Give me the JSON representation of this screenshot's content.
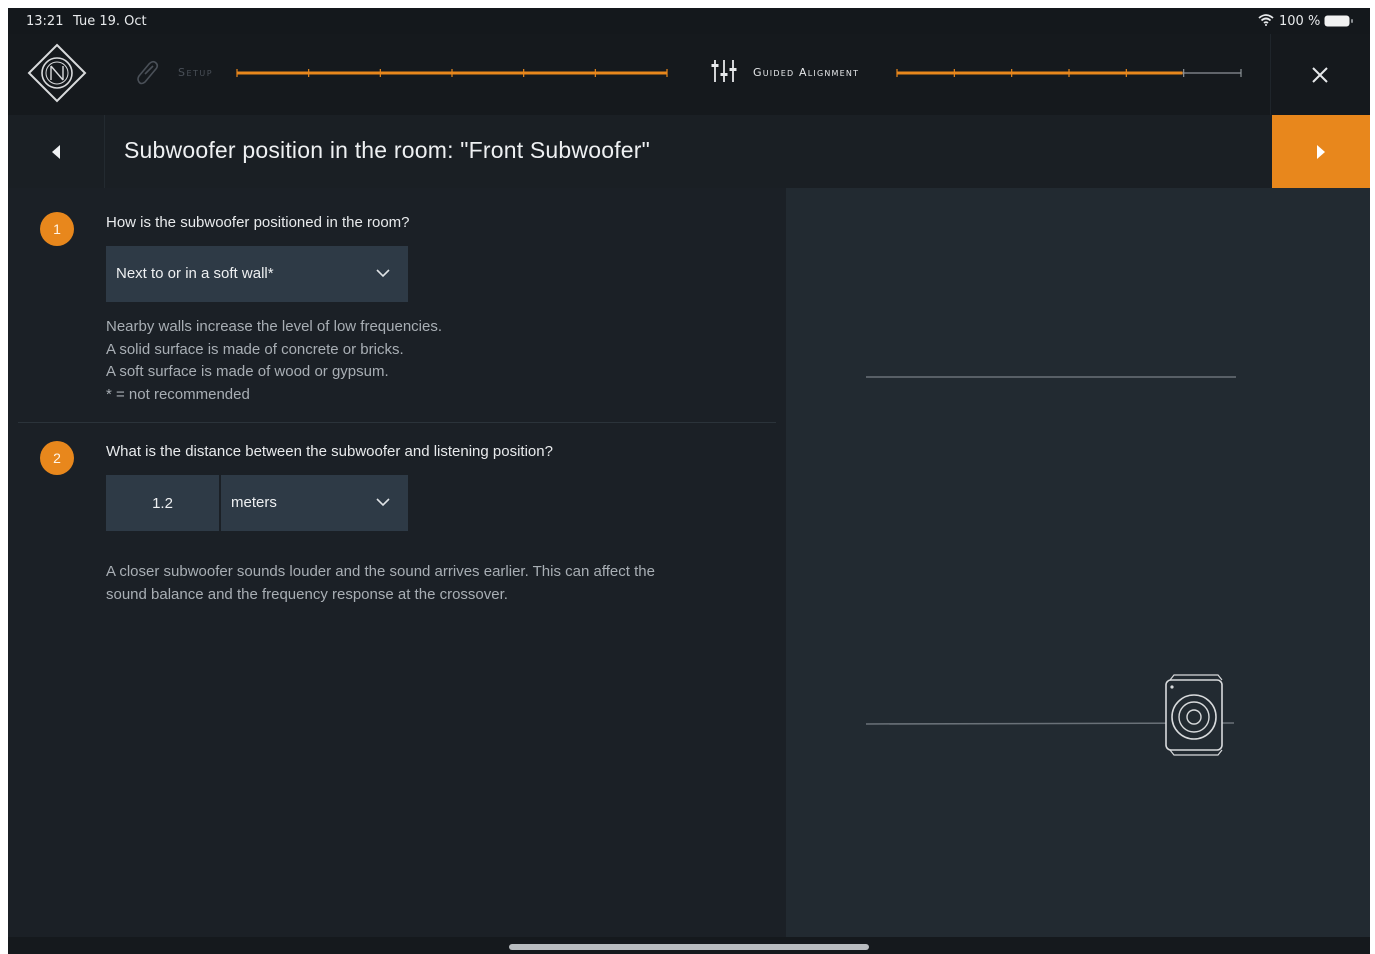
{
  "status_bar": {
    "time": "13:21",
    "date": "Tue 19. Oct",
    "battery": "100 %"
  },
  "nav": {
    "setup_label": "Setup",
    "guided_label": "Guided Alignment",
    "setup_progress": 1.0,
    "guided_progress": 0.83
  },
  "header": {
    "title": "Subwoofer position in the room:  \"Front Subwoofer\""
  },
  "question1": {
    "number": "1",
    "text": "How is the subwoofer positioned in the room?",
    "selected": "Next to or in a soft wall*",
    "help": [
      "Nearby walls increase the level of low frequencies.",
      "A solid surface is made of concrete or bricks.",
      "A soft surface is made of wood or gypsum.",
      "* = not recommended"
    ]
  },
  "question2": {
    "number": "2",
    "text": "What is the distance between the subwoofer and listening position?",
    "distance": "1.2",
    "unit": "meters",
    "help": [
      "A closer subwoofer sounds louder and the sound arrives earlier. This can affect the",
      "sound balance and the frequency response at the crossover."
    ]
  },
  "colors": {
    "accent": "#e8871c",
    "background": "#1b2026",
    "panel": "#222a31"
  }
}
